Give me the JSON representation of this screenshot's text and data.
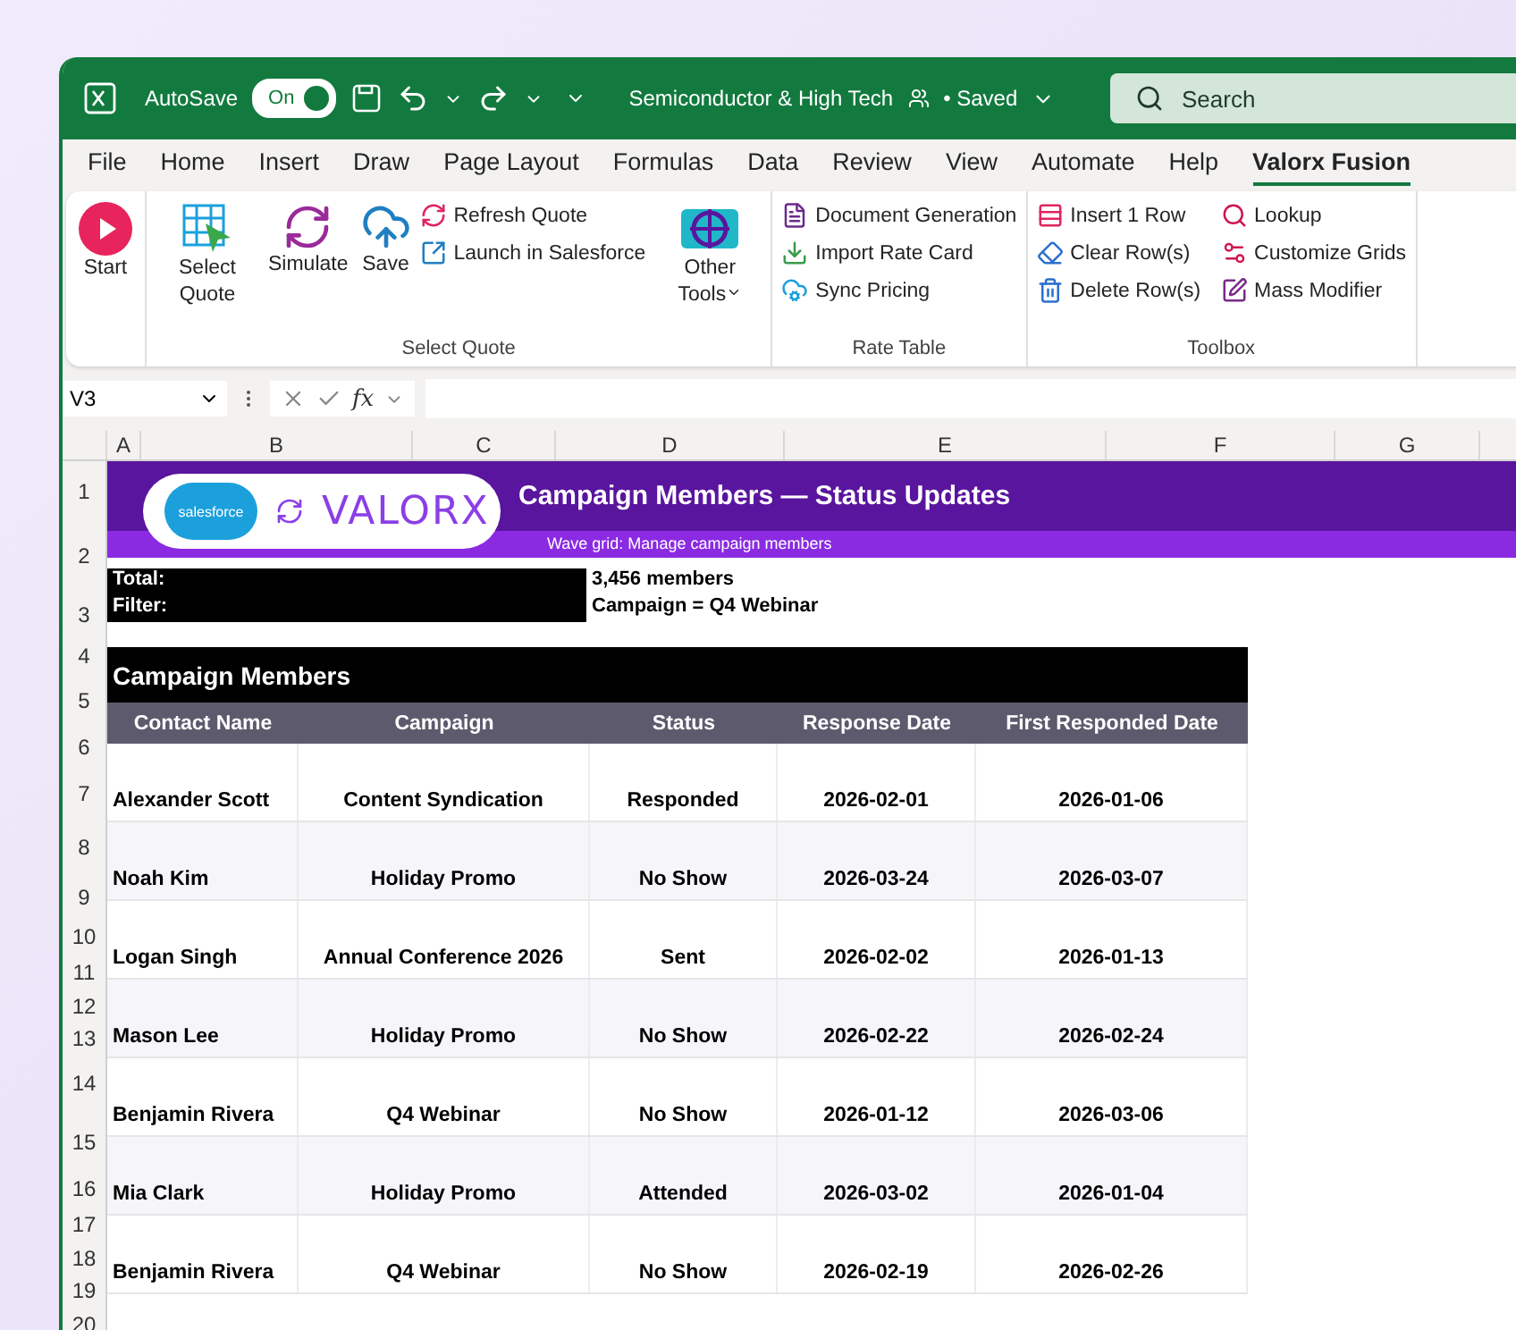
{
  "title_bar": {
    "autosave_label": "AutoSave",
    "autosave_on": true,
    "autosave_state": "On",
    "document_title": "Semiconductor & High Tech",
    "saved_status": "• Saved",
    "search_placeholder": "Search"
  },
  "menu_tabs": [
    {
      "label": "File",
      "selected": false
    },
    {
      "label": "Home",
      "selected": false
    },
    {
      "label": "Insert",
      "selected": false
    },
    {
      "label": "Draw",
      "selected": false
    },
    {
      "label": "Page Layout",
      "selected": false
    },
    {
      "label": "Formulas",
      "selected": false
    },
    {
      "label": "Data",
      "selected": false
    },
    {
      "label": "Review",
      "selected": false
    },
    {
      "label": "View",
      "selected": false
    },
    {
      "label": "Automate",
      "selected": false
    },
    {
      "label": "Help",
      "selected": false
    },
    {
      "label": "Valorx Fusion",
      "selected": true
    }
  ],
  "ribbon_groups": [
    {
      "large": [
        {
          "label": "Start"
        }
      ]
    },
    {
      "label": "Select Quote",
      "large": [
        {
          "label": "Select Quote"
        },
        {
          "label": "Simulate"
        },
        {
          "label": "Save"
        }
      ],
      "small": [
        {
          "label": "Refresh Quote"
        },
        {
          "label": "Launch in Salesforce"
        }
      ],
      "tail": [
        {
          "label": "Other Tools"
        }
      ]
    },
    {
      "label": "Rate Table",
      "small": [
        {
          "label": "Document Generation"
        },
        {
          "label": "Import Rate Card"
        },
        {
          "label": "Sync Pricing"
        }
      ]
    },
    {
      "label": "Toolbox",
      "small": [
        {
          "label": "Insert 1 Row"
        },
        {
          "label": "Clear Row(s)"
        },
        {
          "label": "Delete Row(s)"
        }
      ],
      "small2": [
        {
          "label": "Lookup"
        },
        {
          "label": "Customize Grids"
        },
        {
          "label": "Mass Modifier"
        }
      ]
    }
  ],
  "formula_bar": {
    "name_box": "V3",
    "function_label": "fx"
  },
  "column_headers": [
    "A",
    "B",
    "C",
    "D",
    "E",
    "F",
    "G"
  ],
  "row_numbers": [
    "1",
    "2",
    "3",
    "4",
    "5",
    "6",
    "7",
    "8",
    "9",
    "10",
    "11",
    "12",
    "13",
    "14",
    "15",
    "16",
    "17",
    "18",
    "19",
    "20"
  ],
  "banner": {
    "logo_badge": "salesforce",
    "logo_text": "VALORX",
    "title": "Campaign Members — Status Updates",
    "subtitle": "Wave grid: Manage campaign members"
  },
  "summary": [
    {
      "label": "Total:",
      "value": "3,456 members"
    },
    {
      "label": "Filter:",
      "value": "Campaign = Q4 Webinar"
    }
  ],
  "table": {
    "title": "Campaign Members",
    "columns": [
      "Contact Name",
      "Campaign",
      "Status",
      "Response Date",
      "First Responded Date"
    ],
    "rows": [
      [
        "Alexander Scott",
        "Content Syndication",
        "Responded",
        "2026-02-01",
        "2026-01-06"
      ],
      [
        "Noah Kim",
        "Holiday Promo",
        "No Show",
        "2026-03-24",
        "2026-03-07"
      ],
      [
        "Logan Singh",
        "Annual Conference 2026",
        "Sent",
        "2026-02-02",
        "2026-01-13"
      ],
      [
        "Mason Lee",
        "Holiday Promo",
        "No Show",
        "2026-02-22",
        "2026-02-24"
      ],
      [
        "Benjamin Rivera",
        "Q4 Webinar",
        "No Show",
        "2026-01-12",
        "2026-03-06"
      ],
      [
        "Mia Clark",
        "Holiday Promo",
        "Attended",
        "2026-03-02",
        "2026-01-04"
      ],
      [
        "Benjamin Rivera",
        "Q4 Webinar",
        "No Show",
        "2026-02-19",
        "2026-02-26"
      ]
    ]
  }
}
